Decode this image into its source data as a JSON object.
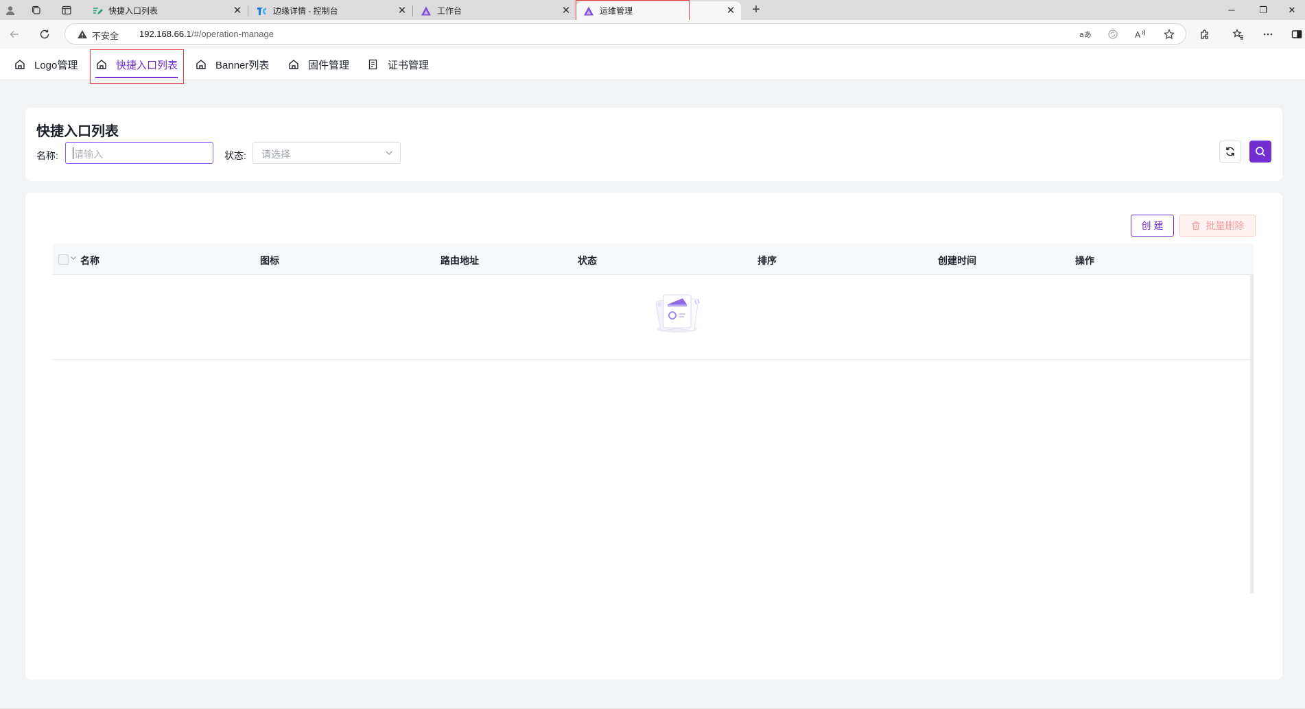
{
  "browser": {
    "tabs": [
      {
        "title": "快捷入口列表",
        "favicon": "pen-list-icon"
      },
      {
        "title": "边缘详情 - 控制台",
        "favicon": "tk-logo-icon"
      },
      {
        "title": "工作台",
        "favicon": "triangle-logo-icon"
      },
      {
        "title": "运维管理",
        "favicon": "triangle-logo-icon",
        "active": true
      }
    ],
    "address": {
      "security_label": "不安全",
      "host": "192.168.66.1",
      "path": "/#/operation-manage"
    }
  },
  "topnav": {
    "items": [
      {
        "label": "Logo管理",
        "icon": "home-icon"
      },
      {
        "label": "快捷入口列表",
        "icon": "home-icon",
        "active": true
      },
      {
        "label": "Banner列表",
        "icon": "home-icon"
      },
      {
        "label": "固件管理",
        "icon": "home-icon"
      },
      {
        "label": "证书管理",
        "icon": "document-icon"
      }
    ]
  },
  "search": {
    "title": "快捷入口列表",
    "name_label": "名称:",
    "name_placeholder": "请输入",
    "status_label": "状态:",
    "status_placeholder": "请选择"
  },
  "toolbar": {
    "create_label": "创建",
    "batch_delete_label": "批量删除"
  },
  "table": {
    "columns": [
      "名称",
      "图标",
      "路由地址",
      "状态",
      "排序",
      "创建时间",
      "操作"
    ],
    "rows": []
  },
  "colors": {
    "accent": "#722ed1",
    "danger_light": "#f29d9d",
    "page_bg": "#f2f3f5"
  }
}
